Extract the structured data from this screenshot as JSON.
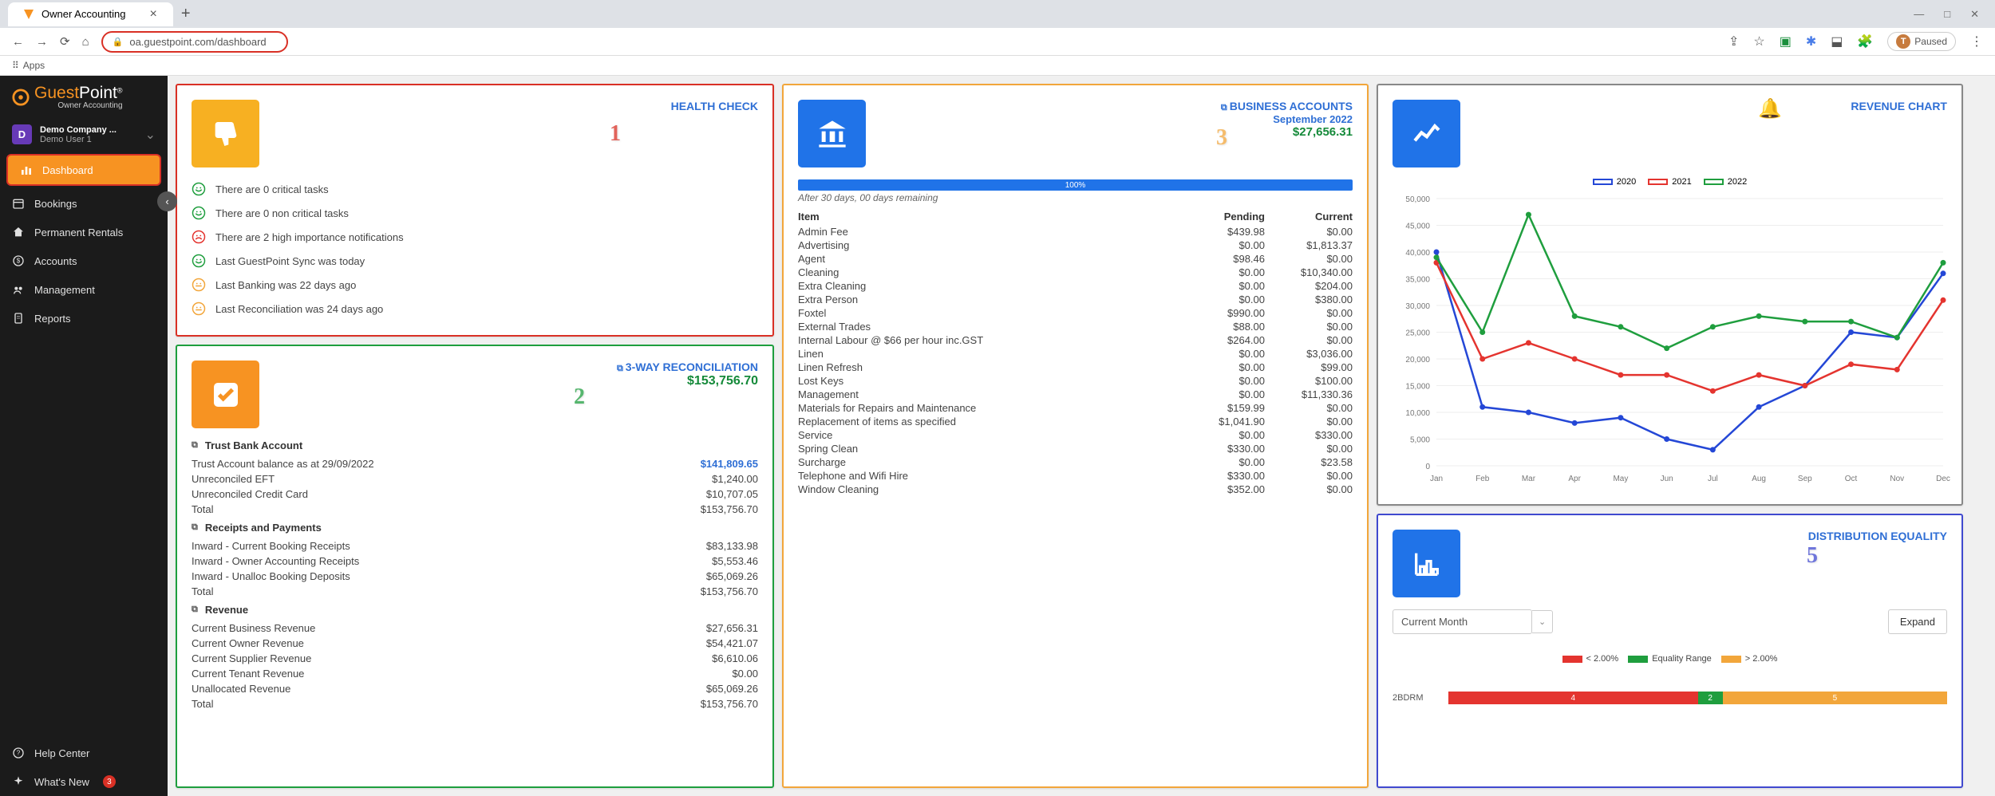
{
  "browser": {
    "tab_title": "Owner Accounting",
    "url": "oa.guestpoint.com/dashboard",
    "apps_label": "Apps",
    "paused": "Paused",
    "user_initial": "T"
  },
  "sidebar": {
    "brand1": "Guest",
    "brand2": "Point",
    "brand_sub": "Owner Accounting",
    "company_initial": "D",
    "company_name": "Demo Company ...",
    "user": "Demo User 1",
    "items": [
      {
        "label": "Dashboard"
      },
      {
        "label": "Bookings"
      },
      {
        "label": "Permanent Rentals"
      },
      {
        "label": "Accounts"
      },
      {
        "label": "Management"
      },
      {
        "label": "Reports"
      }
    ],
    "help": "Help Center",
    "whatsnew": "What's New",
    "notif_count": "3"
  },
  "health_check": {
    "title": "HEALTH CHECK",
    "items": [
      {
        "icon": "smile-green",
        "text": "There are 0 critical tasks"
      },
      {
        "icon": "smile-green",
        "text": "There are 0 non critical tasks"
      },
      {
        "icon": "frown-red",
        "text": "There are 2 high importance notifications"
      },
      {
        "icon": "smile-green",
        "text": "Last GuestPoint Sync was today"
      },
      {
        "icon": "neutral-amber",
        "text": "Last Banking was 22 days ago"
      },
      {
        "icon": "neutral-amber",
        "text": "Last Reconciliation was 24 days ago"
      }
    ]
  },
  "reconciliation": {
    "title": "3-WAY RECONCILIATION",
    "total": "$153,756.70",
    "sections": [
      {
        "name": "Trust Bank Account",
        "rows": [
          {
            "k": "Trust Account balance as at 29/09/2022",
            "v": "$141,809.65",
            "cls": "amt-blue"
          },
          {
            "k": "Unreconciled EFT",
            "v": "$1,240.00"
          },
          {
            "k": "Unreconciled Credit Card",
            "v": "$10,707.05"
          },
          {
            "k": "Total",
            "v": "$153,756.70"
          }
        ]
      },
      {
        "name": "Receipts and Payments",
        "rows": [
          {
            "k": "Inward - Current Booking Receipts",
            "v": "$83,133.98"
          },
          {
            "k": "Inward - Owner Accounting Receipts",
            "v": "$5,553.46"
          },
          {
            "k": "Inward - Unalloc Booking Deposits",
            "v": "$65,069.26"
          },
          {
            "k": "Total",
            "v": "$153,756.70"
          }
        ]
      },
      {
        "name": "Revenue",
        "rows": [
          {
            "k": "Current Business Revenue",
            "v": "$27,656.31"
          },
          {
            "k": "Current Owner Revenue",
            "v": "$54,421.07"
          },
          {
            "k": "Current Supplier Revenue",
            "v": "$6,610.06"
          },
          {
            "k": "Current Tenant Revenue",
            "v": "$0.00"
          },
          {
            "k": "Unallocated Revenue",
            "v": "$65,069.26"
          },
          {
            "k": "Total",
            "v": "$153,756.70"
          }
        ]
      }
    ]
  },
  "business_accounts": {
    "title": "BUSINESS ACCOUNTS",
    "period": "September 2022",
    "amount": "$27,656.31",
    "progress": "100%",
    "remaining": "After 30 days, 00 days remaining",
    "cols": {
      "c1": "Item",
      "c2": "Pending",
      "c3": "Current"
    },
    "rows": [
      {
        "c1": "Admin Fee",
        "c2": "$439.98",
        "c3": "$0.00"
      },
      {
        "c1": "Advertising",
        "c2": "$0.00",
        "c3": "$1,813.37"
      },
      {
        "c1": "Agent",
        "c2": "$98.46",
        "c3": "$0.00"
      },
      {
        "c1": "Cleaning",
        "c2": "$0.00",
        "c3": "$10,340.00"
      },
      {
        "c1": "Extra Cleaning",
        "c2": "$0.00",
        "c3": "$204.00"
      },
      {
        "c1": "Extra Person",
        "c2": "$0.00",
        "c3": "$380.00"
      },
      {
        "c1": "Foxtel",
        "c2": "$990.00",
        "c3": "$0.00"
      },
      {
        "c1": "External Trades",
        "c2": "$88.00",
        "c3": "$0.00"
      },
      {
        "c1": "Internal Labour @ $66 per hour inc.GST",
        "c2": "$264.00",
        "c3": "$0.00"
      },
      {
        "c1": "Linen",
        "c2": "$0.00",
        "c3": "$3,036.00"
      },
      {
        "c1": "Linen Refresh",
        "c2": "$0.00",
        "c3": "$99.00"
      },
      {
        "c1": "Lost Keys",
        "c2": "$0.00",
        "c3": "$100.00"
      },
      {
        "c1": "Management",
        "c2": "$0.00",
        "c3": "$11,330.36"
      },
      {
        "c1": "Materials for Repairs and Maintenance",
        "c2": "$159.99",
        "c3": "$0.00"
      },
      {
        "c1": "Replacement of items as specified",
        "c2": "$1,041.90",
        "c3": "$0.00"
      },
      {
        "c1": "Service",
        "c2": "$0.00",
        "c3": "$330.00"
      },
      {
        "c1": "Spring Clean",
        "c2": "$330.00",
        "c3": "$0.00"
      },
      {
        "c1": "Surcharge",
        "c2": "$0.00",
        "c3": "$23.58"
      },
      {
        "c1": "Telephone and Wifi Hire",
        "c2": "$330.00",
        "c3": "$0.00"
      },
      {
        "c1": "Window Cleaning",
        "c2": "$352.00",
        "c3": "$0.00"
      }
    ]
  },
  "revenue_chart": {
    "title": "REVENUE CHART"
  },
  "chart_data": {
    "type": "line",
    "title": "REVENUE CHART",
    "xlabel": "",
    "ylabel": "",
    "ylim": [
      0,
      50000
    ],
    "categories": [
      "Jan",
      "Feb",
      "Mar",
      "Apr",
      "May",
      "Jun",
      "Jul",
      "Aug",
      "Sep",
      "Oct",
      "Nov",
      "Dec"
    ],
    "series": [
      {
        "name": "2020",
        "color": "#2447d6",
        "values": [
          40000,
          11000,
          10000,
          8000,
          9000,
          5000,
          3000,
          11000,
          15000,
          25000,
          24000,
          36000
        ]
      },
      {
        "name": "2021",
        "color": "#e4342f",
        "values": [
          38000,
          20000,
          23000,
          20000,
          17000,
          17000,
          14000,
          17000,
          15000,
          19000,
          18000,
          31000
        ]
      },
      {
        "name": "2022",
        "color": "#1f9e3e",
        "values": [
          39000,
          25000,
          47000,
          28000,
          26000,
          22000,
          26000,
          28000,
          27000,
          27000,
          24000,
          38000
        ]
      }
    ]
  },
  "distribution": {
    "title": "DISTRIBUTION EQUALITY",
    "period": "Current Month",
    "expand": "Expand",
    "legend": [
      {
        "color": "#e4342f",
        "label": "< 2.00%"
      },
      {
        "color": "#1f9e3e",
        "label": "Equality Range"
      },
      {
        "color": "#f2a63b",
        "label": "> 2.00%"
      }
    ],
    "row_label": "2BDRM",
    "segments": [
      {
        "color": "#e4342f",
        "pct": 50,
        "label": "4"
      },
      {
        "color": "#1f9e3e",
        "pct": 5,
        "label": "2"
      },
      {
        "color": "#f2a63b",
        "pct": 45,
        "label": "5"
      }
    ]
  }
}
